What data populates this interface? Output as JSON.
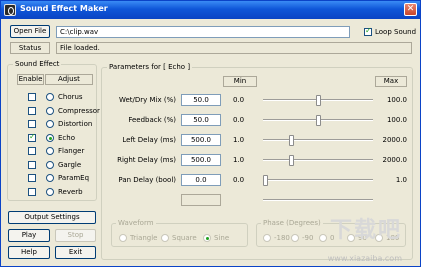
{
  "window": {
    "title": "Sound Effect Maker",
    "close_glyph": "✕"
  },
  "file": {
    "open_label": "Open File",
    "path": "C:\\clip.wav",
    "loop_label": "Loop Sound",
    "loop_checked": true
  },
  "status": {
    "label": "Status",
    "value": "File loaded."
  },
  "effects": {
    "group_label": "Sound Effect",
    "enable_header": "Enable",
    "adjust_header": "Adjust",
    "items": [
      {
        "label": "Chorus",
        "enabled": false,
        "selected": false
      },
      {
        "label": "Compressor",
        "enabled": false,
        "selected": false
      },
      {
        "label": "Distortion",
        "enabled": false,
        "selected": false
      },
      {
        "label": "Echo",
        "enabled": true,
        "selected": true
      },
      {
        "label": "Flanger",
        "enabled": false,
        "selected": false
      },
      {
        "label": "Gargle",
        "enabled": false,
        "selected": false
      },
      {
        "label": "ParamEq",
        "enabled": false,
        "selected": false
      },
      {
        "label": "Reverb",
        "enabled": false,
        "selected": false
      }
    ]
  },
  "buttons": {
    "output_settings": "Output Settings",
    "play": "Play",
    "stop": "Stop",
    "help": "Help",
    "exit": "Exit"
  },
  "params": {
    "group_label": "Parameters for [ Echo ]",
    "min_header": "Min",
    "max_header": "Max",
    "rows": [
      {
        "label": "Wet/Dry Mix (%)",
        "value": "50.0",
        "min": "0.0",
        "max": "100.0",
        "level": 0.5
      },
      {
        "label": "Feedback (%)",
        "value": "50.0",
        "min": "0.0",
        "max": "100.0",
        "level": 0.5
      },
      {
        "label": "Left Delay (ms)",
        "value": "500.0",
        "min": "1.0",
        "max": "2000.0",
        "level": 0.25
      },
      {
        "label": "Right Delay (ms)",
        "value": "500.0",
        "min": "1.0",
        "max": "2000.0",
        "level": 0.25
      },
      {
        "label": "Pan Delay (bool)",
        "value": "0.0",
        "min": "0.0",
        "max": "1.0",
        "level": 0.0
      },
      {
        "label": "",
        "value": "",
        "min": "",
        "max": "",
        "level": 0.0
      }
    ]
  },
  "waveform": {
    "group_label": "Waveform",
    "options": [
      "Triangle",
      "Square",
      "Sine"
    ],
    "selected": "Sine"
  },
  "phase": {
    "group_label": "Phase (Degrees)",
    "options": [
      "-180",
      "-90",
      "0",
      "90",
      "180"
    ]
  },
  "watermark": {
    "text": "下载吧",
    "sub": "www.xiazaiba.com"
  }
}
